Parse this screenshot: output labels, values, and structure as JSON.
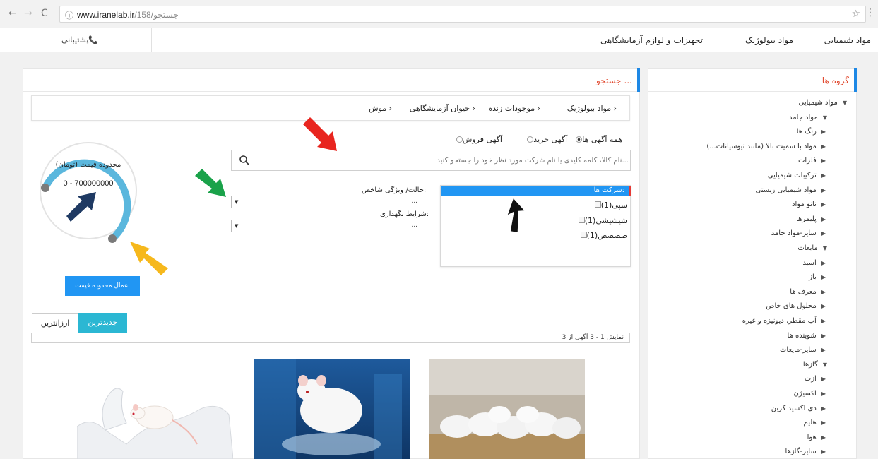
{
  "browser": {
    "url_host": "www.iranelab.ir",
    "url_path": "/158/جستجو"
  },
  "topnav": {
    "links": [
      "مواد شیمیایی",
      "مواد بیولوژیک",
      "تجهیزات و لوازم آزمایشگاهی"
    ],
    "support": "پشتیبانی"
  },
  "sidebar": {
    "title": "گروه ها",
    "items": [
      "مواد شیمیایی",
      "مواد جامد",
      "رنگ ها",
      "مواد با سمیت بالا (مانند تیوسیانات...)",
      "فلزات",
      "ترکیبات شیمیایی",
      "مواد شیمیایی زیستی",
      "نانو مواد",
      "پلیمرها",
      "سایر-مواد جامد",
      "مایعات",
      "اسید",
      "باز",
      "معرف ها",
      "محلول های خاص",
      "آب مقطر، دیونیزه و غیره",
      "شوینده ها",
      "سایر-مایعات",
      "گازها",
      "ازت",
      "اکسیژن",
      "دی اکسید کربن",
      "هلیم",
      "هوا",
      "سایر-گازها"
    ]
  },
  "search": {
    "title": "جستجو ...",
    "breadcrumb": [
      "مواد بیولوژیک",
      "موجودات زنده",
      "حیوان آزمایشگاهی",
      "موش"
    ],
    "ad_types": [
      "همه آگهی ها",
      "آگهی خرید",
      "آگهی فروش"
    ],
    "placeholder": "نام کالا، کلمه کلیدی یا نام شرکت مورد نظر خود را جستجو کنید..."
  },
  "filters": {
    "state_label": "حالت/ ویژگی شاخص:",
    "storage_label": "شرایط نگهداری:",
    "select_value": "..."
  },
  "companies": {
    "title": "شرکت ها:",
    "items": [
      "سپی(1)",
      "شیشیشی(1)",
      "صصصص(1)"
    ]
  },
  "price": {
    "title": "محدوده قیمت (تومان)",
    "range": "0 - 700000000",
    "apply": "اعمال محدوده قیمت"
  },
  "sort_tabs": [
    "جدیدترین",
    "ارزانترین"
  ],
  "results_text": "نمایش 1 - 3 آگهی از 3",
  "colors": {
    "accent_blue": "#2196f3",
    "title_red": "#e0452a",
    "tab_teal": "#2bb7d3",
    "arrow_red": "#e8251f",
    "arrow_green": "#1aa24a",
    "arrow_black": "#111111",
    "arrow_navy": "#1f3a63",
    "arrow_yellow": "#f6b81c"
  }
}
